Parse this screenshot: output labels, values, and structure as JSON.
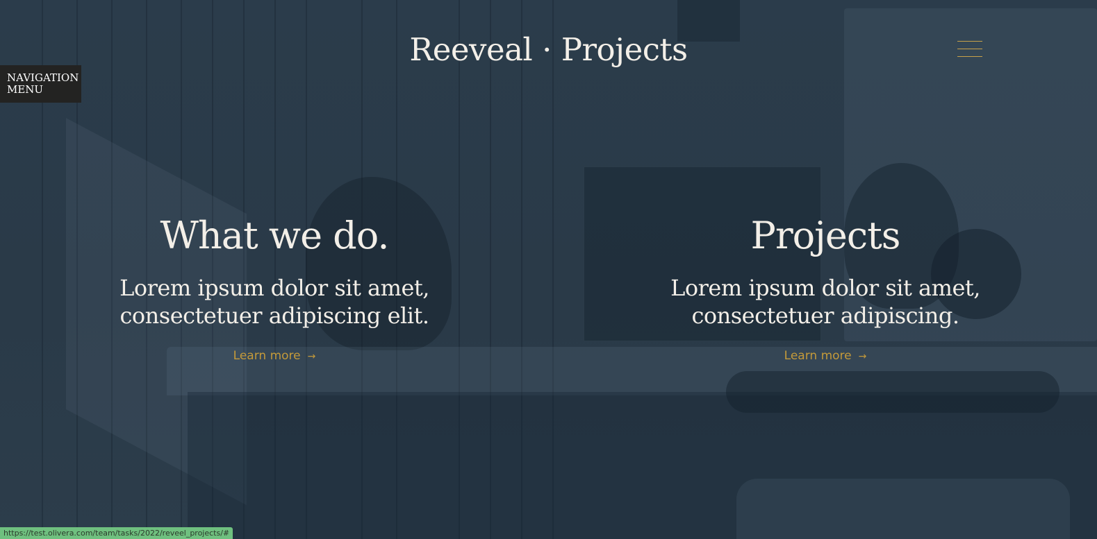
{
  "header": {
    "brand": "Reeveal · Projects",
    "menu_icon": "hamburger-icon"
  },
  "nav_tab": {
    "line1": "NAVIGATION",
    "line2": "MENU"
  },
  "sections": [
    {
      "title": "What we do.",
      "body_line1": "Lorem ipsum dolor sit amet,",
      "body_line2": "consectetuer adipiscing elit.",
      "link": "Learn more",
      "link_icon": "arrow-right-icon"
    },
    {
      "title": "Projects",
      "body_line1": "Lorem ipsum dolor sit amet,",
      "body_line2": "consectetuer adipiscing.",
      "link": "Learn more",
      "link_icon": "arrow-right-icon"
    }
  ],
  "statusbar": {
    "url": "https://test.olivera.com/team/tasks/2022/reveel_projects/#"
  },
  "colors": {
    "background": "#2a3b4a",
    "accent": "#c49a3a",
    "text": "#f3efe8",
    "nav_tab": "#232322",
    "status_bar": "#6fc07f"
  }
}
